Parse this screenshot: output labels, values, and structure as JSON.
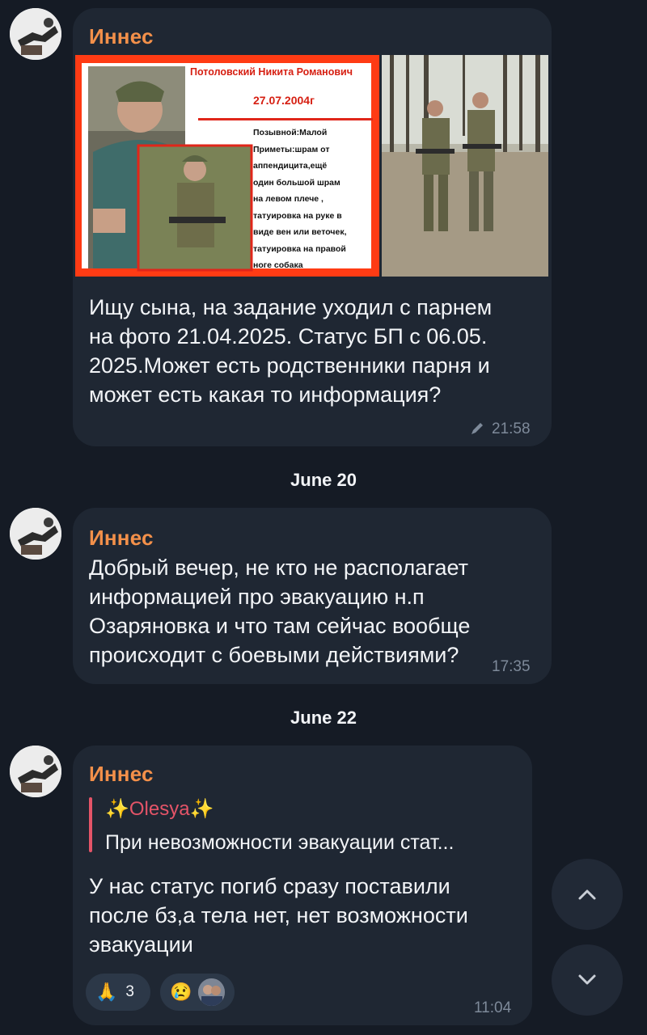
{
  "messages": [
    {
      "sender": "Иннес",
      "poster": {
        "name": "Потоловский Никита Романович",
        "date": "27.07.2004г",
        "lines": [
          "Позывной:Малой",
          "Приметы:шрам от",
          "аппендицита,ещё",
          "один большой шрам",
          "на левом плече ,",
          "татуировка на руке в",
          "виде вен или веточек,",
          "татуировка на правой",
          "ноге собака"
        ]
      },
      "text_lines": [
        "Ищу сына, на задание уходил с парнем",
        "на фото 21.04.2025. Статус БП с 06.05.",
        "2025.Может есть родственники парня и",
        "может есть какая то информация?"
      ],
      "time": "21:58",
      "edited_icon": "pencil-icon"
    },
    {
      "date_separator": "June 20",
      "sender": "Иннес",
      "text_lines": [
        "Добрый вечер, не кто не располагает",
        "информацией про эвакуацию  н.п",
        "Озаряновка и что там сейчас вообще",
        "происходит с боевыми действиями?"
      ],
      "time": "17:35"
    },
    {
      "date_separator": "June 22",
      "sender": "Иннес",
      "reply": {
        "name": "✨Olesya✨",
        "text": "При невозможности эвакуации стат..."
      },
      "text_lines": [
        "У нас статус погиб сразу поставили",
        "после бз,а тела нет, нет возможности",
        "эвакуации"
      ],
      "reactions": [
        {
          "emoji": "🙏",
          "count": "3"
        },
        {
          "emoji": "😢",
          "count": ""
        }
      ],
      "time": "11:04"
    }
  ],
  "colors": {
    "background": "#151b25",
    "bubble": "#1f2733",
    "sender": "#f3904a",
    "reply_accent": "#e45468",
    "timestamp": "#7e8a9a"
  },
  "scroll_buttons": {
    "up_icon": "chevron-up-icon",
    "down_icon": "chevron-down-icon"
  }
}
